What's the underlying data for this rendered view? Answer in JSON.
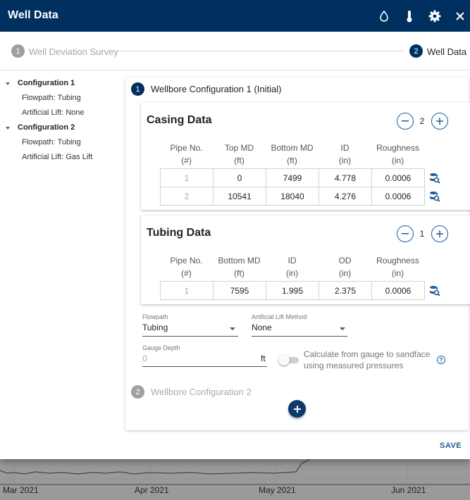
{
  "dialog": {
    "title": "Well Data",
    "icons": [
      "water-drop-icon",
      "thermometer-icon",
      "gear-icon",
      "close-icon"
    ]
  },
  "stepper": {
    "steps": [
      {
        "number": "1",
        "label": "Well Deviation Survey",
        "state": "inactive"
      },
      {
        "number": "2",
        "label": "Well Data",
        "state": "active"
      }
    ]
  },
  "tree": {
    "nodes": [
      {
        "label": "Configuration 1",
        "level": 0
      },
      {
        "label": "Flowpath: Tubing",
        "level": 1
      },
      {
        "label": "Artificial Lift: None",
        "level": 1
      },
      {
        "label": "Configuration 2",
        "level": 0
      },
      {
        "label": "Flowpath: Tubing",
        "level": 1
      },
      {
        "label": "Artificial Lift: Gas Lift",
        "level": 1
      }
    ]
  },
  "config1": {
    "number": "1",
    "title": "Wellbore Configuration 1 (Initial)",
    "casing": {
      "title": "Casing Data",
      "count": "2",
      "headers": [
        [
          "Pipe No.",
          "(#)"
        ],
        [
          "Top MD",
          "(ft)"
        ],
        [
          "Bottom MD",
          "(ft)"
        ],
        [
          "ID",
          "(in)"
        ],
        [
          "Roughness",
          "(in)"
        ]
      ],
      "rows": [
        [
          "1",
          "0",
          "7499",
          "4.778",
          "0.0006"
        ],
        [
          "2",
          "10541",
          "18040",
          "4.276",
          "0.0006"
        ]
      ]
    },
    "tubing": {
      "title": "Tubing Data",
      "count": "1",
      "headers": [
        [
          "Pipe No.",
          "(#)"
        ],
        [
          "Bottom MD",
          "(ft)"
        ],
        [
          "ID",
          "(in)"
        ],
        [
          "OD",
          "(in)"
        ],
        [
          "Roughness",
          "(in)"
        ]
      ],
      "rows": [
        [
          "1",
          "7595",
          "1.995",
          "2.375",
          "0.0006"
        ]
      ]
    },
    "flowpath": {
      "label": "Flowpath",
      "value": "Tubing"
    },
    "artificial_lift": {
      "label": "Artificial Lift Method",
      "value": "None"
    },
    "gauge_depth": {
      "label": "Gauge Depth",
      "placeholder": "0",
      "unit": "ft"
    },
    "toggle": {
      "label": "Calculate from gauge to sandface using measured pressures",
      "checked": false
    }
  },
  "config2": {
    "number": "2",
    "title": "Wellbore Configuration 2"
  },
  "actions": {
    "save": "SAVE"
  },
  "background_chart": {
    "x_labels": [
      "Mar 2021",
      "Apr 2021",
      "May 2021",
      "Jun 2021"
    ]
  },
  "colors": {
    "primary": "#00305f",
    "accent": "#1a5d99",
    "inactive_step": "#9e9e9e"
  }
}
